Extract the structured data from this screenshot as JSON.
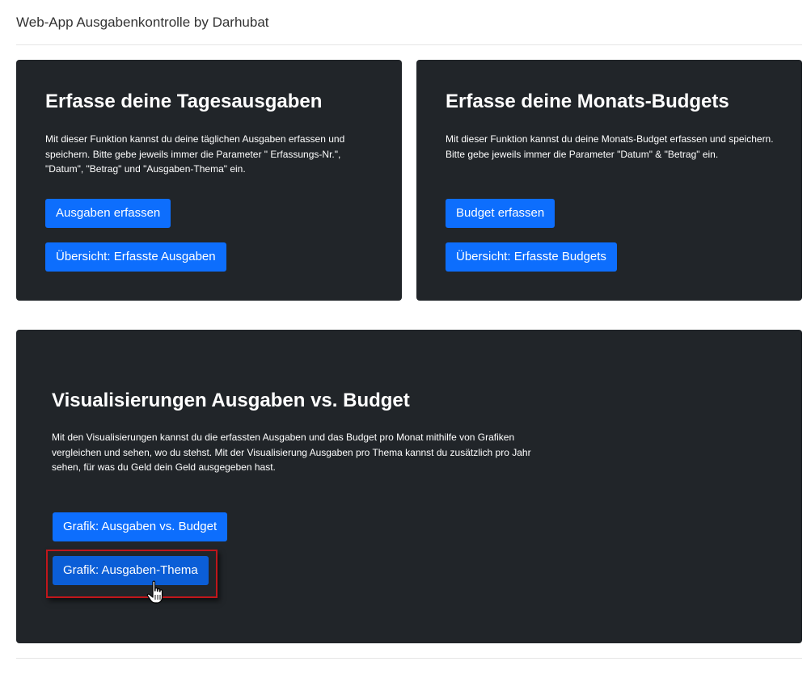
{
  "header": {
    "title": "Web-App Ausgabenkontrolle by Darhubat"
  },
  "card_daily": {
    "title": "Erfasse deine Tagesausgaben",
    "text": "Mit dieser Funktion kannst du deine täglichen Ausgaben erfassen und speichern. Bitte gebe jeweils immer die Parameter \" Erfassungs-Nr.\", \"Datum\", \"Betrag\" und \"Ausgaben-Thema\" ein.",
    "button_add": "Ausgaben erfassen",
    "button_overview": "Übersicht: Erfasste Ausgaben"
  },
  "card_budget": {
    "title": "Erfasse deine Monats-Budgets",
    "text": "Mit dieser Funktion kannst du deine Monats-Budget erfassen und speichern. Bitte gebe jeweils immer die Parameter \"Datum\" & \"Betrag\" ein.",
    "button_add": "Budget erfassen",
    "button_overview": "Übersicht: Erfasste Budgets"
  },
  "card_visual": {
    "title": "Visualisierungen Ausgaben vs. Budget",
    "text": "Mit den Visualisierungen kannst du die erfassten Ausgaben und das Budget pro Monat mithilfe von Grafiken vergleichen und sehen, wo du stehst. Mit der Visualisierung Ausgaben pro Thema kannst du zusätzlich pro Jahr sehen, für was du Geld dein Geld ausgegeben hast.",
    "button_chart_budget": "Grafik: Ausgaben vs. Budget",
    "button_chart_topic": "Grafik: Ausgaben-Thema"
  },
  "colors": {
    "card_bg": "#212529",
    "button_primary": "#0d6efd",
    "highlight": "#c0161b"
  }
}
